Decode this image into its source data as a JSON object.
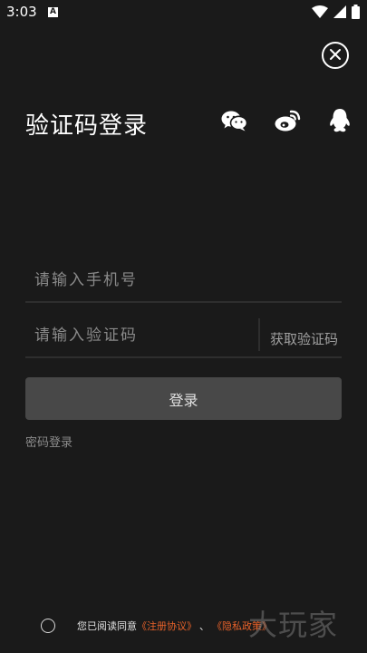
{
  "status_bar": {
    "time": "3:03",
    "notification_badge": "A",
    "icons": [
      "wifi-icon",
      "signal-icon",
      "battery-icon"
    ]
  },
  "login": {
    "title": "验证码登录",
    "social_icons": [
      "wechat-icon",
      "weibo-icon",
      "qq-icon"
    ],
    "phone_placeholder": "请输入手机号",
    "code_placeholder": "请输入验证码",
    "get_code_label": "获取验证码",
    "login_button_label": "登录",
    "password_login_label": "密码登录"
  },
  "agreement": {
    "prefix": "您已阅读同意",
    "terms_link": "《注册协议》",
    "separator": "、",
    "privacy_link": "《隐私政策》"
  },
  "watermark": "大玩家",
  "colors": {
    "background": "#1a1a1a",
    "link": "#e8622a",
    "button": "#484848"
  }
}
